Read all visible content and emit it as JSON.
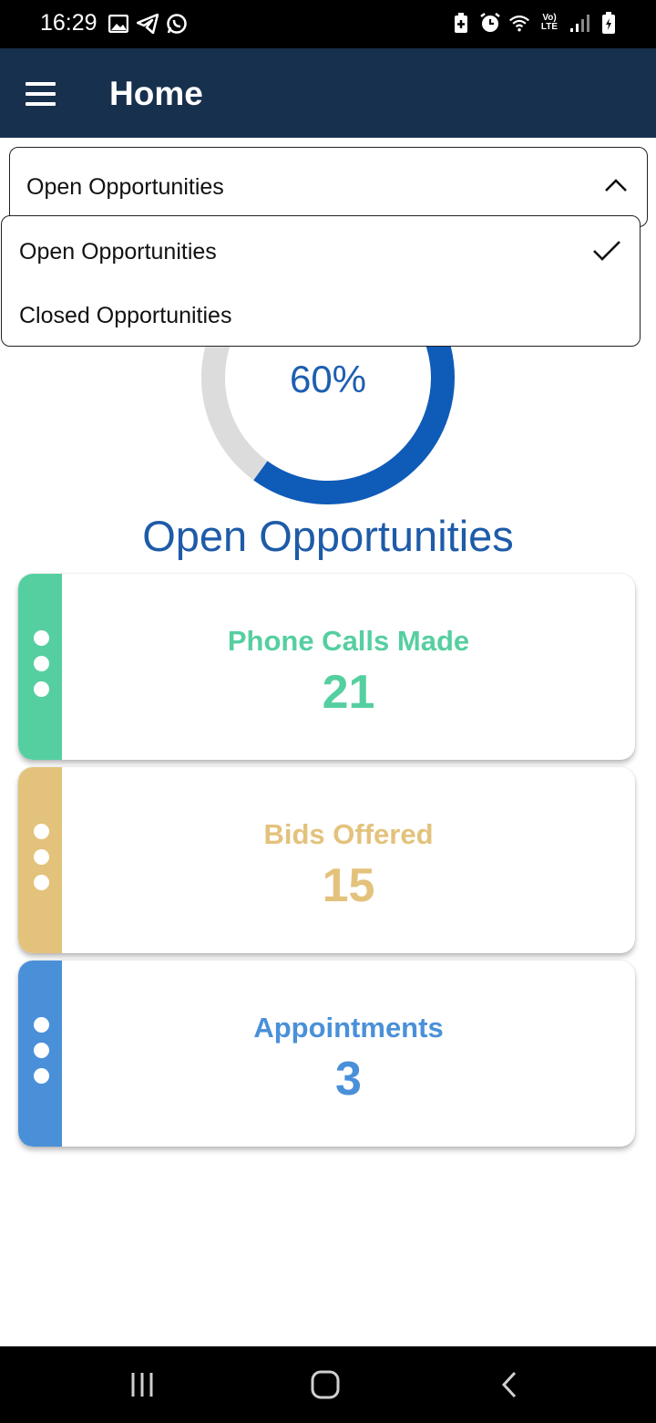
{
  "status_bar": {
    "time": "16:29"
  },
  "app_bar": {
    "title": "Home"
  },
  "select": {
    "value": "Open Opportunities"
  },
  "dropdown": {
    "options": [
      "Open Opportunities",
      "Closed Opportunities"
    ],
    "selected": "Open Opportunities"
  },
  "progress": {
    "percent_label": "60%",
    "fraction": 0.6
  },
  "section": {
    "title": "Open Opportunities"
  },
  "cards": [
    {
      "label": "Phone Calls Made",
      "value": "21",
      "color": "#56cfa0"
    },
    {
      "label": "Bids Offered",
      "value": "15",
      "color": "#e3c27c"
    },
    {
      "label": "Appointments",
      "value": "3",
      "color": "#4a90d9"
    }
  ],
  "colors": {
    "app_bar": "#17304d",
    "donut_fill": "#0f5bb8",
    "donut_track": "#dcdcdc"
  }
}
